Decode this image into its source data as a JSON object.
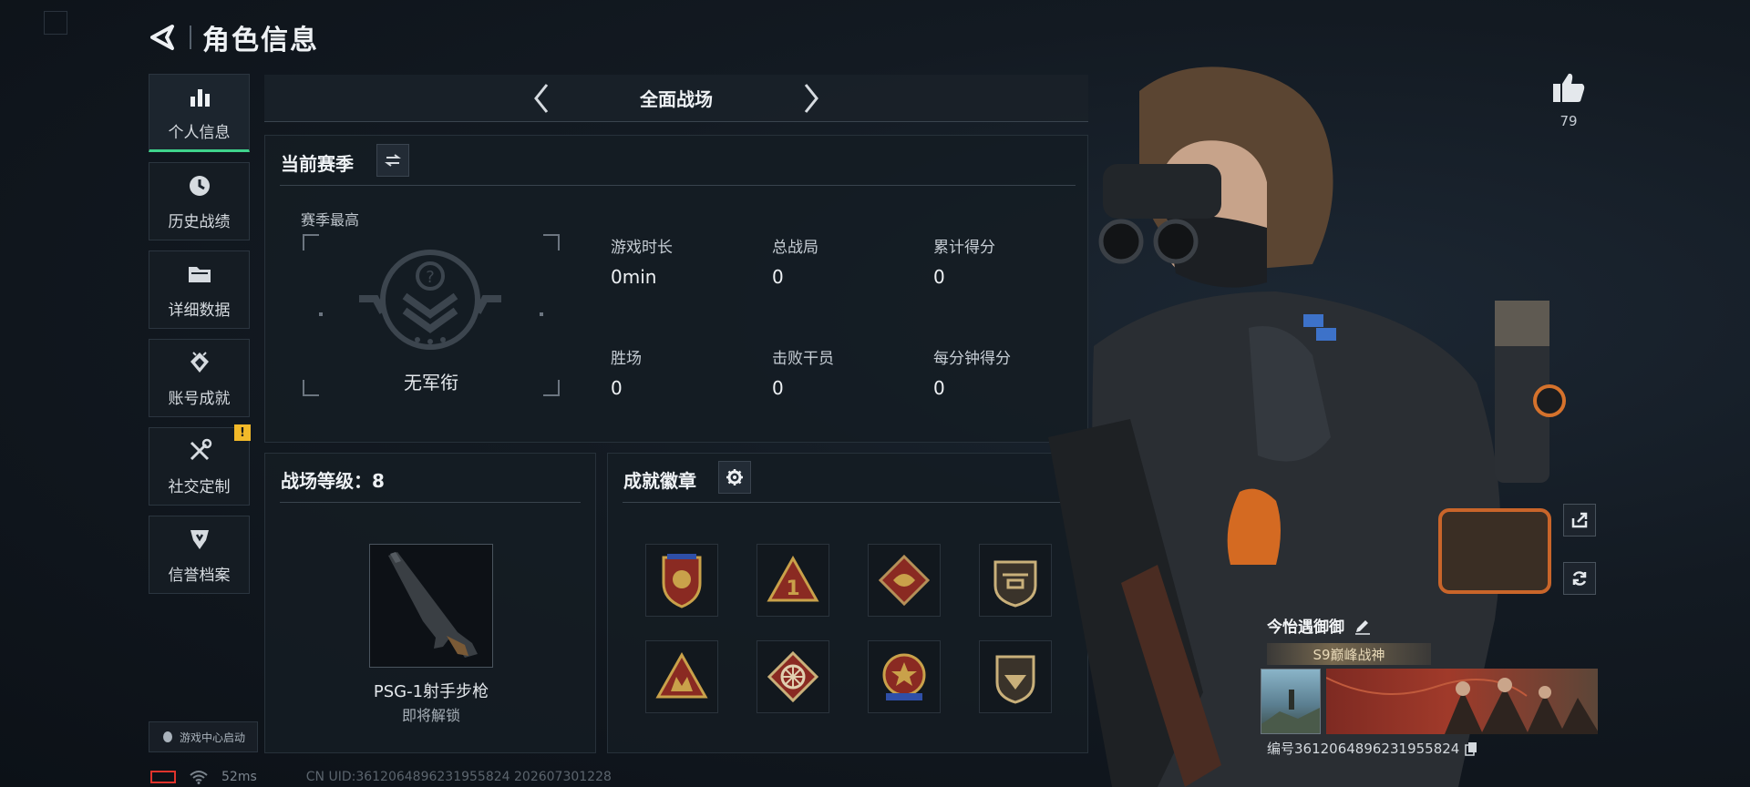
{
  "header": {
    "title": "角色信息"
  },
  "sidebar": {
    "items": [
      {
        "label": "个人信息",
        "icon": "bar-chart-icon",
        "active": true
      },
      {
        "label": "历史战绩",
        "icon": "clock-icon"
      },
      {
        "label": "详细数据",
        "icon": "folder-icon"
      },
      {
        "label": "账号成就",
        "icon": "trophy-icon"
      },
      {
        "label": "社交定制",
        "icon": "tools-icon",
        "alert": "!"
      },
      {
        "label": "信誉档案",
        "icon": "shield-icon"
      }
    ],
    "game_center": "游戏中心启动"
  },
  "mode": {
    "title": "全面战场"
  },
  "season": {
    "title": "当前赛季",
    "season_high_label": "赛季最高",
    "rank_name": "无军衔",
    "stats": [
      {
        "key": "游戏时长",
        "value": "0min"
      },
      {
        "key": "总战局",
        "value": "0"
      },
      {
        "key": "累计得分",
        "value": "0"
      },
      {
        "key": "胜场",
        "value": "0"
      },
      {
        "key": "击败干员",
        "value": "0"
      },
      {
        "key": "每分钟得分",
        "value": "0"
      }
    ]
  },
  "battlefield": {
    "title": "战场等级：8",
    "weapon_name": "PSG-1射手步枪",
    "weapon_status": "即将解锁"
  },
  "achievements": {
    "title": "成就徽章",
    "badge_count": 8
  },
  "profile": {
    "likes": "79",
    "player_name": "今怡遇御御",
    "title_tag": "S9巅峰战神",
    "player_id": "编号3612064896231955824"
  },
  "status": {
    "ping": "52ms",
    "uid": "CN UID:3612064896231955824 202607301228"
  },
  "colors": {
    "accent_green": "#3fd48c",
    "alert_yellow": "#f2b929",
    "battery_red": "#e0342c"
  }
}
